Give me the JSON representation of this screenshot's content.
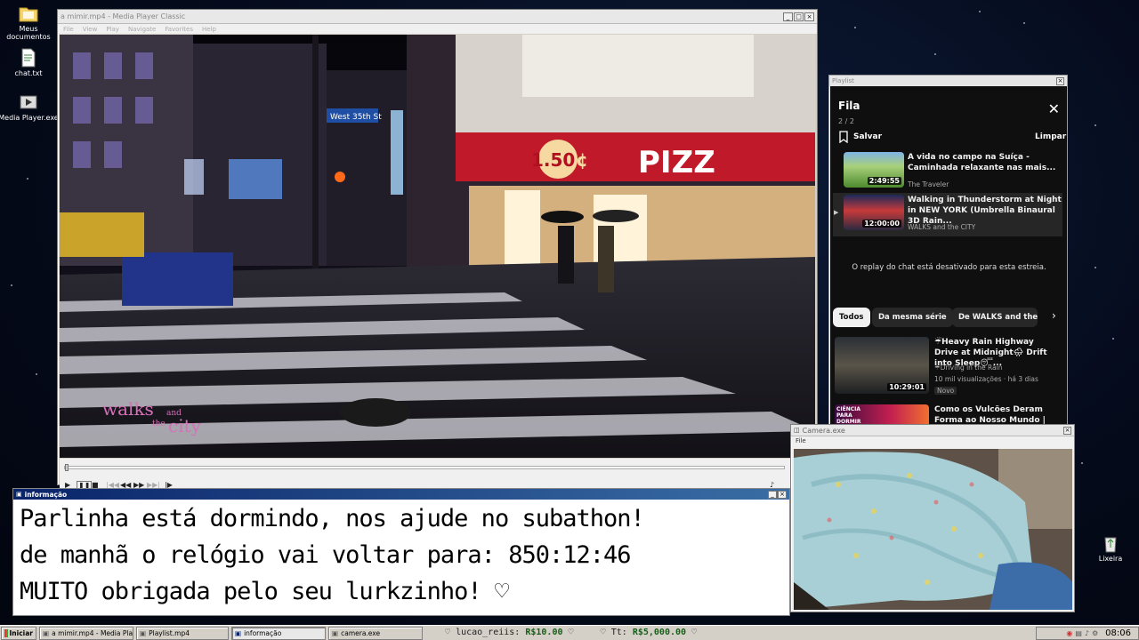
{
  "desktop": {
    "icons": [
      {
        "label": "Meus documentos",
        "icon": "folder-icon"
      },
      {
        "label": "chat.txt",
        "icon": "text-file-icon"
      },
      {
        "label": "Media Player.exe",
        "icon": "media-player-icon"
      },
      {
        "label": "Lixeira",
        "icon": "recycle-bin-icon"
      }
    ]
  },
  "media_player": {
    "title": "a mimir.mp4 - Media Player Classic",
    "menu": [
      "File",
      "View",
      "Play",
      "Navigate",
      "Favorites",
      "Help"
    ],
    "video": {
      "street_sign": "West 35th St",
      "store_price": "1.50",
      "store_cents": "¢",
      "store_name": "PIZZ",
      "watermark_line1": "walks",
      "watermark_and": "and",
      "watermark_line2": "the",
      "watermark_city": "city"
    },
    "seek_progress": 0.0
  },
  "playlist": {
    "window_title": "Playlist",
    "heading": "Fila",
    "count": "2 / 2",
    "save_label": "Salvar",
    "clear_label": "Limpar",
    "items": [
      {
        "title": "A vida no campo na Suíça - Caminhada relaxante nas mais...",
        "channel": "The Traveler",
        "duration": "2:49:55"
      },
      {
        "title": "Walking in Thunderstorm at Night in NEW YORK (Umbrella Binaural 3D Rain...",
        "channel": "WALKS and the CITY",
        "duration": "12:00:00"
      }
    ],
    "chat_notice": "O replay do chat está desativado para esta estreia.",
    "chips": [
      "Todos",
      "Da mesma série",
      "De WALKS and the CITY"
    ],
    "recommendations": [
      {
        "title": "☔Heavy Rain Highway Drive at Midnight🌧 Drift into Sleep😴...",
        "channel": "☔Driving in the Rain",
        "stats": "10 mil visualizações · há 3 dias",
        "badge": "Novo",
        "duration": "10:29:01"
      },
      {
        "title": "Como os Vulcões Deram Forma ao Nosso Mundo | Ciência Par...",
        "thumb_text": "CIÊNCIA PARA DORMIR"
      }
    ]
  },
  "camera": {
    "title": "Camera.exe",
    "menu": "File"
  },
  "info": {
    "title": "informação",
    "lines": [
      "Parlinha está dormindo, nos ajude no subathon!",
      "de manhã o relógio vai voltar para:  850:12:46",
      "MUITO obrigada pelo seu lurkzinho! ♡"
    ]
  },
  "taskbar": {
    "start_label": "Iniciar",
    "buttons": [
      "a mimir.mp4 - Media Player...",
      "Playlist.mp4",
      "informação",
      "camera.exe"
    ],
    "active_button": 2,
    "ticker": {
      "user_label": "lucao_reiis:",
      "user_amount": "R$10.00",
      "total_label": "Tt:",
      "total_amount": "R$5,000.00"
    },
    "clock": "08:06"
  },
  "colors": {
    "desktop_bg": "#050b1c",
    "title_blue": "#0a246a",
    "playlist_bg": "#0f0f0f",
    "ticker_green": "#186018"
  }
}
